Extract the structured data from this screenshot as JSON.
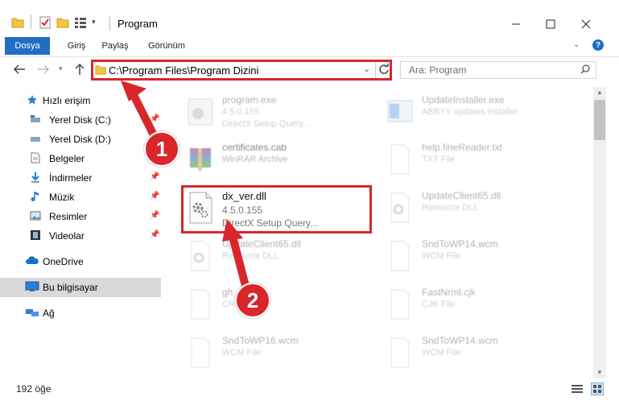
{
  "window": {
    "title": "Program",
    "help": "?"
  },
  "ribbon": {
    "tabs": [
      {
        "label": "Dosya"
      },
      {
        "label": "Giriş"
      },
      {
        "label": "Paylaş"
      },
      {
        "label": "Görünüm"
      }
    ]
  },
  "address": {
    "path": "C:\\Program Files\\Program Dizini"
  },
  "search": {
    "placeholder": "Ara: Program"
  },
  "sidebar": {
    "items": [
      {
        "label": "Hızlı erişim"
      },
      {
        "label": "Yerel Disk (C:)"
      },
      {
        "label": "Yerel Disk (D:)"
      },
      {
        "label": "Belgeler"
      },
      {
        "label": "İndirmeler"
      },
      {
        "label": "Müzik"
      },
      {
        "label": "Resimler"
      },
      {
        "label": "Videolar"
      },
      {
        "label": "OneDrive"
      },
      {
        "label": "Bu bilgisayar"
      },
      {
        "label": "Ağ"
      }
    ]
  },
  "files": [
    {
      "name": "program.exe",
      "line1": "4.5.0.155",
      "line2": "DirectX Setup Query..."
    },
    {
      "name": "UpdateInstaller.exe",
      "line1": "ABBYY updates installer",
      "line2": ""
    },
    {
      "name": "certificates.cab",
      "line1": "WinRAR Archive",
      "line2": ""
    },
    {
      "name": "help.fineReader.txt",
      "line1": "TXT File",
      "line2": ""
    },
    {
      "name": "dx_ver.dll",
      "line1": "4.5.0.155",
      "line2": "DirectX Setup Query..."
    },
    {
      "name": "UpdateClient65.dll",
      "line1": "Resource DLL",
      "line2": ""
    },
    {
      "name": "UpdateClient65.dll",
      "line1": "Resource DLL",
      "line2": ""
    },
    {
      "name": "SndToWP14.wcm",
      "line1": "WCM File",
      "line2": ""
    },
    {
      "name": "gh",
      "line1": "CR",
      "line2": ""
    },
    {
      "name": "FastNrml.cjk",
      "line1": "CJK File",
      "line2": ""
    },
    {
      "name": "SndToWP16.wcm",
      "line1": "WCM File",
      "line2": ""
    },
    {
      "name": "SndToWP14.wcm",
      "line1": "WCM File",
      "line2": ""
    }
  ],
  "callouts": [
    "1",
    "2"
  ],
  "status": {
    "count": "192 öğe"
  },
  "colors": {
    "accent": "#1e6fc4",
    "highlight": "#d9262b"
  }
}
